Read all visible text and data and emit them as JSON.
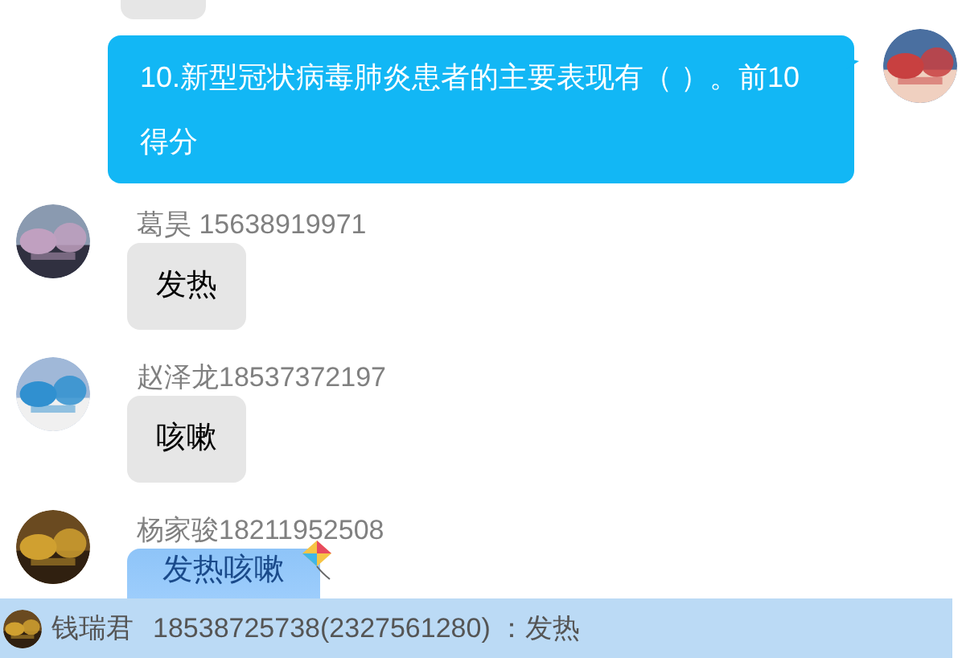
{
  "messages": [
    {
      "kind": "clipped"
    },
    {
      "kind": "own",
      "text": "10.新型冠状病毒肺炎患者的主要表现有（ ）。前10得分"
    },
    {
      "kind": "text",
      "sender": "葛昊 15638919971",
      "text": "发热"
    },
    {
      "kind": "text",
      "sender": "赵泽龙18537372197",
      "text": "咳嗽"
    },
    {
      "kind": "fancy",
      "sender": "杨家骏18211952508",
      "text": "发热咳嗽"
    }
  ],
  "notice": {
    "name": "钱瑞君",
    "text": "18538725738(2327561280) ：发热"
  }
}
